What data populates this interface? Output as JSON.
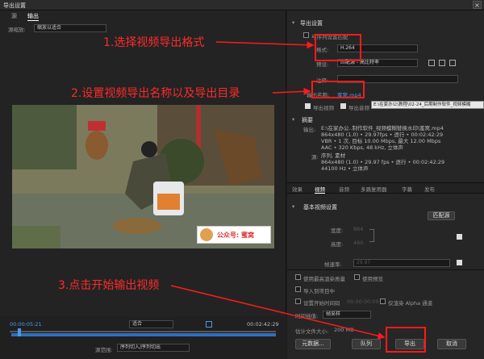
{
  "window": {
    "title": "导出设置",
    "close": "×"
  },
  "left_tabs": [
    "源",
    "输出"
  ],
  "scaling": {
    "label": "源缩放:",
    "value": "缩放以适合"
  },
  "annotations": {
    "a1": "1.选择视频导出格式",
    "a2": "2.设置视频导出名称以及导出目录",
    "a3": "3.点击开始输出视频"
  },
  "video": {
    "watermark": "公众号: 蜜窝"
  },
  "timeline": {
    "start_time": "00:00:05:21",
    "end_time": "00:02:42:29",
    "fit": "适合",
    "range_label": "源范围:",
    "range_value": "序列切入/序列切出"
  },
  "export_settings": {
    "header": "导出设置",
    "match_seq": "与序列设置匹配",
    "format_label": "格式:",
    "format_value": "H.264",
    "preset_label": "预设:",
    "preset_value": "匹配源 - 高比特率",
    "comment_label": "注释:",
    "output_label": "输出名称:",
    "output_value": "蜜窝.mp4",
    "tooltip": "E:\\在家办公\\教程\\02-24_后期制作软件_视频模糊",
    "export_video": "导出视频",
    "export_audio": "导出音频"
  },
  "summary": {
    "header": "摘要",
    "output_label": "输出:",
    "output_lines": [
      "E:\\在家办公..制作软件_视频模糊替换水印\\蜜窝.mp4",
      "864x480 (1.0) • 29.97fps • 逐行 • 00:02:42:29",
      "VBR • 1 次, 目标 10.00 Mbps, 最大 12.00 Mbps",
      "AAC • 320 Kbps, 48 kHz, 立体声"
    ],
    "source_label": "源:",
    "source_lines": [
      "序列, 素材",
      "864x480 (1.0) • 29.97 fps • 逐行 • 00:02:42:29",
      "44100 Hz • 立体声"
    ]
  },
  "right_tabs": [
    "效果",
    "视频",
    "音频",
    "多路复用器",
    "字幕",
    "发布"
  ],
  "basic_video": {
    "header": "基本视频设置",
    "match_source": "匹配源",
    "width_label": "宽度:",
    "width_value": "864",
    "height_label": "高度:",
    "height_value": "480",
    "framerate_label": "帧速率:",
    "framerate_value": "29.97"
  },
  "options": {
    "max_render": "使用最高渲染质量",
    "use_preview": "使用预览",
    "import_project": "导入到项目中",
    "set_start_tc": "设置开始时间码",
    "start_tc_value": "00:00:00:00",
    "alpha_only": "仅渲染 Alpha 通道",
    "interp_label": "时间插值:",
    "interp_value": "帧采样",
    "filesize_label": "估计文件大小:",
    "filesize_value": "200 MB"
  },
  "buttons": {
    "metadata": "元数据...",
    "queue": "队列",
    "export": "导出",
    "cancel": "取消"
  },
  "colors": {
    "annotation": "#ff2a2a",
    "accent": "#2e6fbf"
  }
}
